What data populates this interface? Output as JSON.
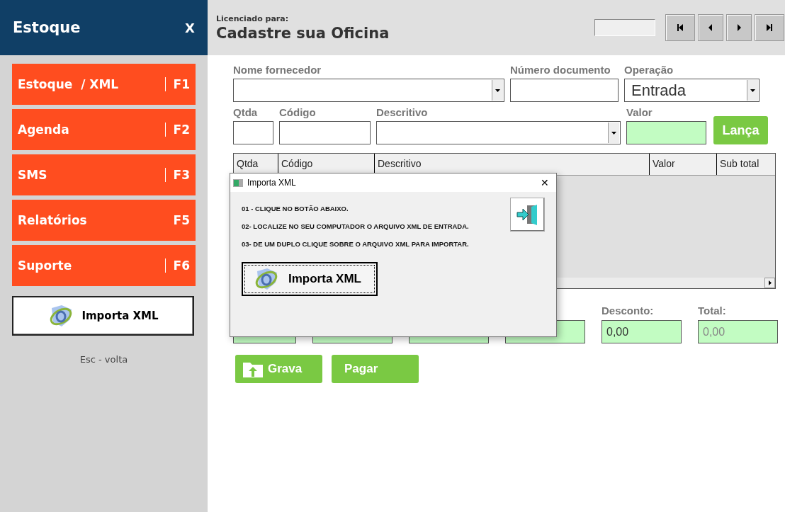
{
  "sidebar": {
    "title": "Estoque",
    "close": "X",
    "items": [
      {
        "label": "Estoque  / XML",
        "key": "F1",
        "divider": true
      },
      {
        "label": "Agenda",
        "key": "F2",
        "divider": true
      },
      {
        "label": "SMS",
        "key": "F3",
        "divider": true
      },
      {
        "label": "Relatórios",
        "key": "F5",
        "divider": false
      },
      {
        "label": "Suporte",
        "key": "F6",
        "divider": true
      }
    ],
    "import_button": "Importa XML",
    "hint": "Esc - volta"
  },
  "header": {
    "license_label": "Licenciado para:",
    "license_name": "Cadastre sua Oficina"
  },
  "form": {
    "supplier_fields": [
      {
        "label": "Nome fornecedor",
        "kind": "select"
      },
      {
        "label": "Número documento",
        "kind": "text"
      },
      {
        "label": "Operação",
        "kind": "select",
        "value": "Entrada"
      }
    ],
    "item_fields": [
      {
        "label": "Qtda",
        "kind": "text"
      },
      {
        "label": "Código",
        "kind": "text"
      },
      {
        "label": "Descritivo",
        "kind": "select"
      },
      {
        "label": "Valor",
        "kind": "money"
      }
    ],
    "add_button": "Lança"
  },
  "table": {
    "columns": [
      "Qtda",
      "Código",
      "Descritivo",
      "Valor",
      "Sub total"
    ]
  },
  "totals": {
    "discount": {
      "label": "Desconto:",
      "value": "0,00"
    },
    "total": {
      "label": "Total:",
      "placeholder": "0,00"
    }
  },
  "actions": [
    {
      "label": "Grava",
      "kind": "save"
    },
    {
      "label": "Pagar",
      "kind": "plain"
    }
  ],
  "dialog": {
    "title": "Importa XML",
    "steps": [
      "01 - CLIQUE NO BOTÃO ABAIXO.",
      "02- LOCALIZE NO SEU COMPUTADOR O ARQUIVO XML DE ENTRADA.",
      "03- DE UM DUPLO CLIQUE SOBRE O ARQUIVO XML PARA IMPORTAR."
    ],
    "close": "✕",
    "import_button": "Importa XML"
  }
}
